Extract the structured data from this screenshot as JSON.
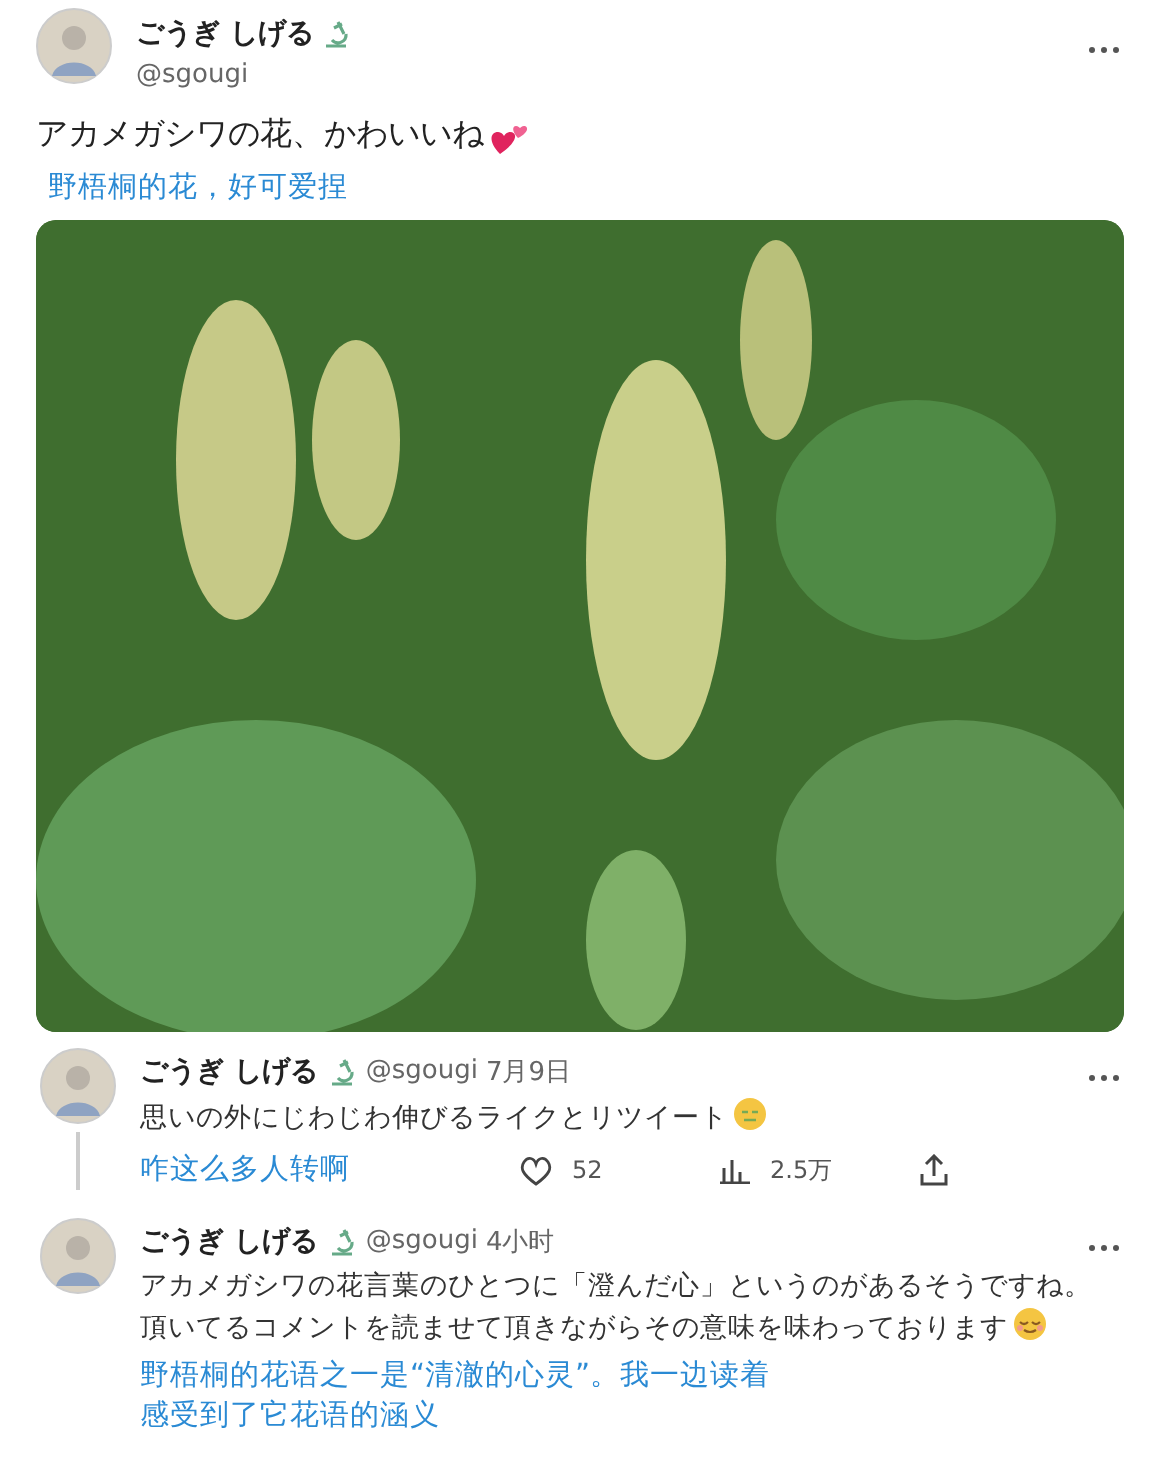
{
  "post": {
    "name": "ごうぎ しげる",
    "handle": "@sgougi",
    "text": "アカメガシワの花、かわいいね",
    "translation": [
      "野梧桐的花，好可爱捏"
    ]
  },
  "replies": [
    {
      "name": "ごうぎ しげる",
      "handle": "@sgougi",
      "time": "7月9日",
      "threaded": true,
      "lines": [
        "思いの外にじわじわ伸びるライクとリツイート"
      ],
      "translation": [
        "咋这么多人转啊"
      ],
      "stats": {
        "likes": "52",
        "views": "2.5万"
      }
    },
    {
      "name": "ごうぎ しげる",
      "handle": "@sgougi",
      "time": "4小时",
      "threaded": false,
      "lines": [
        "アカメガシワの花言葉のひとつに「澄んだ心」というのがあるそうですね。",
        "頂いてるコメントを読ませて頂きながらその意味を味わっております"
      ],
      "translation": [
        "野梧桐的花语之一是“清澈的心灵”。我一边读着",
        "感受到了它花语的涵义"
      ]
    }
  ]
}
